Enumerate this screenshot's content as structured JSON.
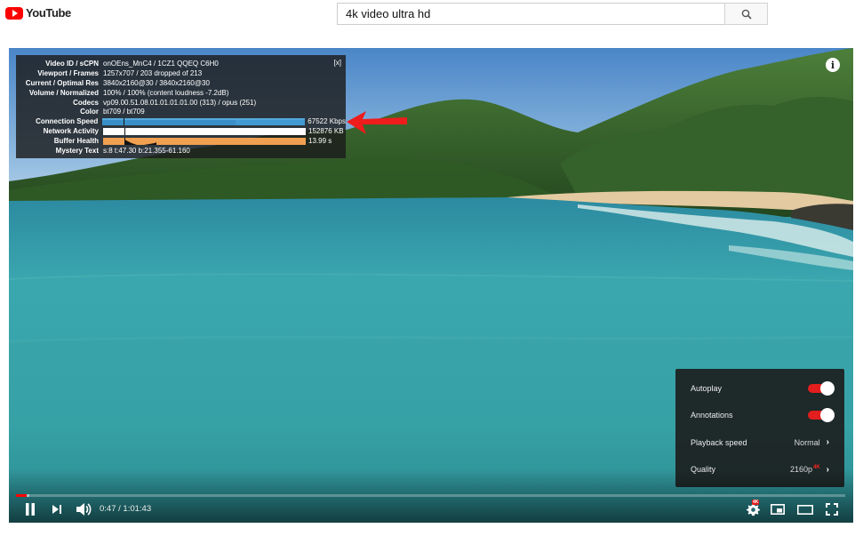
{
  "app": {
    "logo_text": "YouTube"
  },
  "search": {
    "value": "4k video ultra hd",
    "button_icon": "search-icon"
  },
  "stats": {
    "close_label": "[x]",
    "rows": [
      {
        "label": "Video ID / sCPN",
        "value": "onOEns_MnC4 / 1CZ1 QQEQ C6H0"
      },
      {
        "label": "Viewport / Frames",
        "value": "1257x707 / 203 dropped of 213"
      },
      {
        "label": "Current / Optimal Res",
        "value": "3840x2160@30 / 3840x2160@30"
      },
      {
        "label": "Volume / Normalized",
        "value": "100% / 100% (content loudness -7.2dB)"
      },
      {
        "label": "Codecs",
        "value": "vp09.00.51.08.01.01.01.01.00 (313) / opus (251)"
      },
      {
        "label": "Color",
        "value": "bt709 / bt709"
      },
      {
        "label": "Connection Speed",
        "value": "67522 Kbps"
      },
      {
        "label": "Network Activity",
        "value": "152876 KB"
      },
      {
        "label": "Buffer Health",
        "value": "13.99 s"
      },
      {
        "label": "Mystery Text",
        "value": "s:8 t:47.30 b:21.355-61.160"
      }
    ],
    "colors": {
      "connection": "#3a8fc8",
      "network": "#ffffff",
      "buffer": "#f0a050"
    }
  },
  "menu": {
    "items": [
      {
        "label": "Autoplay",
        "type": "toggle",
        "on": true
      },
      {
        "label": "Annotations",
        "type": "toggle",
        "on": true
      },
      {
        "label": "Playback speed",
        "value": "Normal"
      },
      {
        "label": "Quality",
        "value": "2160p",
        "badge": "4K"
      }
    ]
  },
  "player": {
    "current_time": "0:47",
    "separator": " / ",
    "duration": "1:01:43",
    "time_text": "0:47 / 1:01:43",
    "progress_played": 0.0127,
    "progress_loaded": 0.0165,
    "settings_badge": "4K",
    "accent": "#ff0000"
  }
}
